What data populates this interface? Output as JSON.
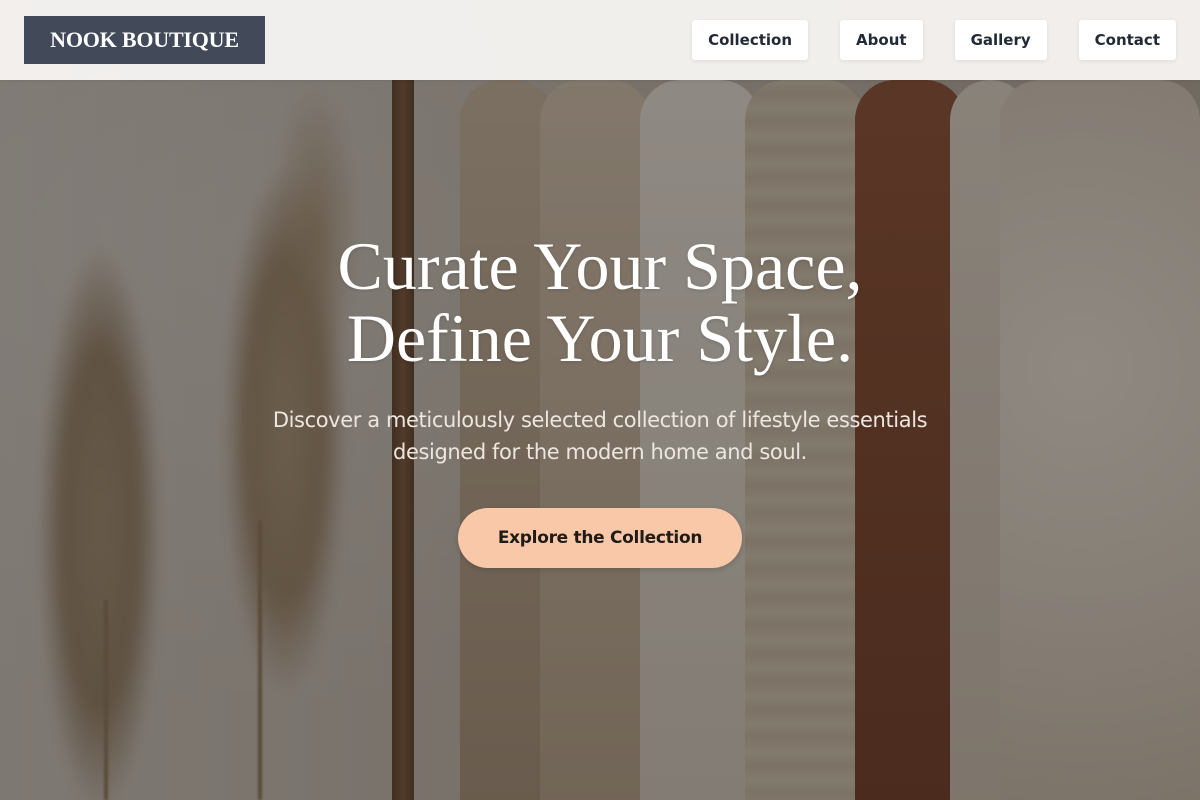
{
  "brand": {
    "name": "NOOK BOUTIQUE",
    "logo_bg_color": "#424a5a"
  },
  "nav": {
    "items": [
      {
        "label": "Collection"
      },
      {
        "label": "About"
      },
      {
        "label": "Gallery"
      },
      {
        "label": "Contact"
      }
    ]
  },
  "hero": {
    "title_line1": "Curate Your Space,",
    "title_line2": "Define Your Style.",
    "subtitle": "Discover a meticulously selected collection of lifestyle essentials designed for the modern home and soul.",
    "cta_label": "Explore the Collection",
    "cta_color": "#f9c8a8",
    "background_image": "clothing-rack-photo"
  }
}
